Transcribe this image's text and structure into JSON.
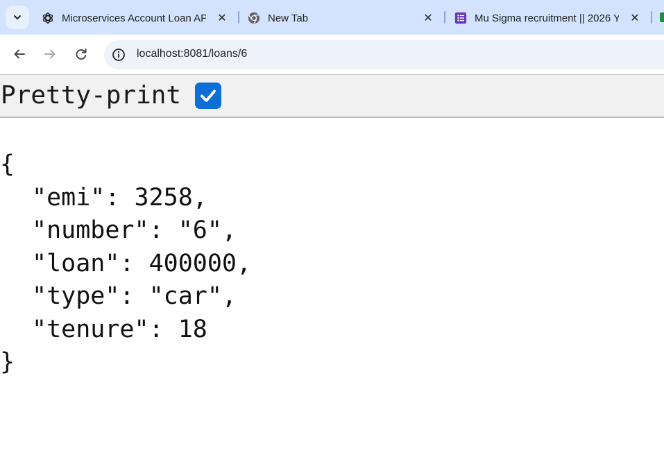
{
  "browser": {
    "tabs": [
      {
        "title": "Microservices Account Loan API",
        "icon": "openai-icon",
        "active": false
      },
      {
        "title": "New Tab",
        "icon": "chrome-icon",
        "active": false
      },
      {
        "title": "Mu Sigma recruitment || 2026 Y",
        "icon": "google-forms-icon",
        "active": false
      }
    ],
    "url": "localhost:8081/loans/6"
  },
  "viewer": {
    "pretty_print_label": "Pretty-print",
    "pretty_print_checked": true
  },
  "json_lines": {
    "open": "{",
    "emi": "\"emi\": 3258,",
    "number": "\"number\": \"6\",",
    "loan": "\"loan\": 400000,",
    "type": "\"type\": \"car\",",
    "tenure": "\"tenure\": 18",
    "close": "}"
  },
  "colors": {
    "tabstrip_bg": "#d3e3fd",
    "checkbox_accent": "#0b6fd6",
    "forms_purple": "#673ab7"
  }
}
